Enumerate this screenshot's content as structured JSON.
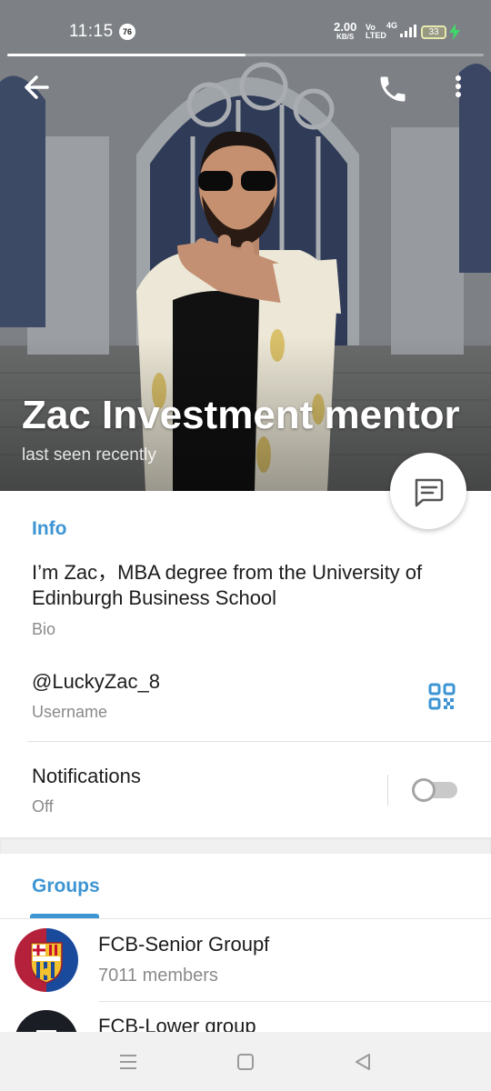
{
  "status_bar": {
    "time": "11:15",
    "notification_badge": "76",
    "net_speed": "2.00",
    "net_speed_unit": "KB/S",
    "volte": "Vo LTED",
    "network": "4G",
    "battery": "33"
  },
  "media_progress": 0.5,
  "header": {
    "name": "Zac Investment mentor",
    "status": "last seen recently",
    "icons": {
      "back": "back-arrow-icon",
      "call": "phone-icon",
      "more": "more-vertical-icon",
      "message": "message-icon"
    }
  },
  "info": {
    "section_title": "Info",
    "bio": "I’m Zac，MBA degree from the University of Edinburgh Business School",
    "bio_label": "Bio",
    "username": "@LuckyZac_8",
    "username_label": "Username",
    "notifications_label": "Notifications",
    "notifications_value": "Off",
    "notifications_enabled": false
  },
  "groups": {
    "section_title": "Groups",
    "items": [
      {
        "name": "FCB-Senior Groupf",
        "members": "7011 members"
      },
      {
        "name": "FCB-Lower group",
        "members": ""
      }
    ]
  },
  "colors": {
    "accent": "#3d95d3",
    "text": "#1c1c1c",
    "muted": "#8a8a8a"
  },
  "nav": {
    "icons": [
      "menu-icon",
      "home-square-icon",
      "back-triangle-icon"
    ]
  }
}
